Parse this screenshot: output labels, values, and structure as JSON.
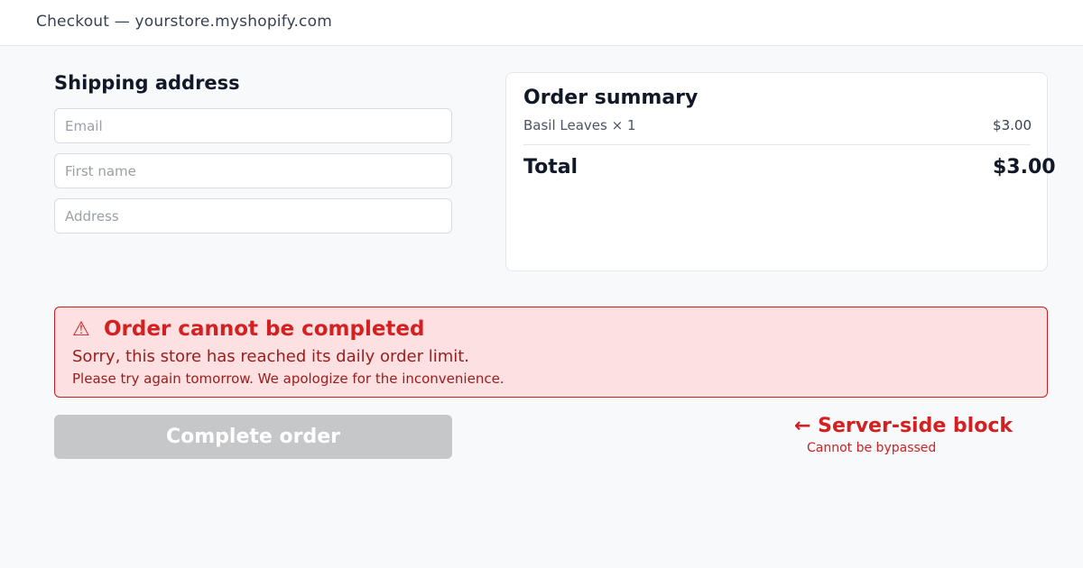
{
  "header": {
    "title": "Checkout — yourstore.myshopify.com"
  },
  "shipping": {
    "title": "Shipping address",
    "fields": {
      "email": {
        "value": "",
        "placeholder": "Email"
      },
      "first_name": {
        "value": "",
        "placeholder": "First name"
      },
      "address": {
        "value": "",
        "placeholder": "Address"
      }
    }
  },
  "summary": {
    "title": "Order summary",
    "items": [
      {
        "name": "Basil Leaves × 1",
        "price": "$3.00"
      }
    ],
    "total_label": "Total",
    "total_value": "$3.00"
  },
  "alert": {
    "icon": "warning-icon",
    "icon_glyph": "⚠",
    "title": "Order cannot be completed",
    "message": "Sorry, this store has reached its daily order limit.",
    "detail": "Please try again tomorrow. We apologize for the inconvenience.",
    "color": "#d42020",
    "background": "#fde0e1"
  },
  "actions": {
    "complete_label": "Complete order",
    "complete_disabled": true
  },
  "annotation": {
    "title": "← Server-side block",
    "subtitle": "Cannot be bypassed"
  }
}
